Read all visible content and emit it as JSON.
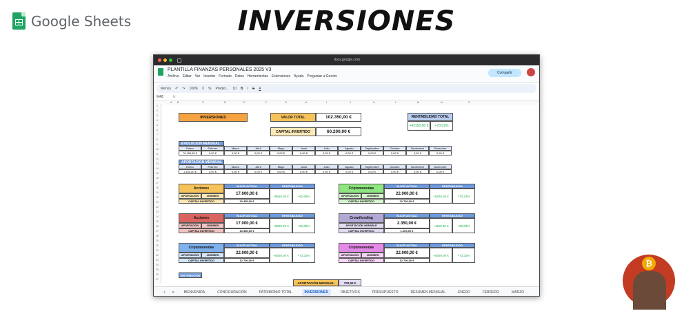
{
  "header": {
    "logo_text": "Google Sheets",
    "title": "INVERSIONES"
  },
  "browser": {
    "url": "docs.google.com"
  },
  "doc": {
    "title": "PLANTILLA FINANZAS PERSONALES 2025 V3",
    "menus": [
      "Archivo",
      "Editar",
      "Ver",
      "Insertar",
      "Formato",
      "Datos",
      "Herramientas",
      "Extensiones",
      "Ayuda",
      "Preguntar a Gemini"
    ],
    "share_label": "Compartir"
  },
  "toolbar": {
    "menus": "Menús",
    "zoom": "100%",
    "font": "Predet...",
    "font_size": "10"
  },
  "formula": {
    "cell_ref": "M48",
    "fx": "fx"
  },
  "columns": [
    "A",
    "B",
    "C",
    "D",
    "E",
    "F",
    "G",
    "H",
    "I",
    "J",
    "K",
    "L",
    "M",
    "N",
    "O"
  ],
  "summary": {
    "inversiones": "INVERSIONES",
    "valor_total_label": "VALOR TOTAL",
    "valor_total": "102.350,00 €",
    "capital_label": "CAPITAL INVERTIDO",
    "capital": "60.200,00 €",
    "rent_label": "RENTABILIDAD TOTAL",
    "rent_eur": "+42150,00 €",
    "rent_pct": "+70,02%"
  },
  "evolucion": {
    "label": "EVOLUCIÓN MENSUAL",
    "months": [
      "Enero",
      "Febrero",
      "Marzo",
      "Abril",
      "Mayo",
      "Junio",
      "Julio",
      "Agosto",
      "Septiembre",
      "Octubre",
      "Noviembre",
      "Diciembre"
    ],
    "values": [
      "76.163,89 €",
      "0,00 €",
      "0,00 €",
      "0,00 €",
      "0,00 €",
      "0,00 €",
      "0,00 €",
      "0,00 €",
      "0,00 €",
      "0,00 €",
      "0,00 €",
      "0,00 €"
    ]
  },
  "aportacion_mensual": {
    "label": "APORTACIÓN MENSUAL",
    "values": [
      "1.400,00 €",
      "0,00 €",
      "0,00 €",
      "0,00 €",
      "0,00 €",
      "0,00 €",
      "0,00 €",
      "0,00 €",
      "0,00 €",
      "0,00 €",
      "0,00 €",
      "0,00 €"
    ]
  },
  "blocks": [
    {
      "name": "Acciones",
      "color": "#f6c25a",
      "light": "#fde8b6",
      "ap_label": "APORTACIÓN",
      "ap_val": "400€/MES",
      "cap_label": "CAPITAL INVERTIDO",
      "va_label": "VALOR ACTUAL",
      "va": "17.000,00 €",
      "cap": "10.450,00 €",
      "rent_label": "RENTABILIDAD",
      "r1": "+6550,00 €",
      "r2": "+62,68%"
    },
    {
      "name": "Criptomonedas",
      "color": "#8ee680",
      "light": "#d6f6cf",
      "ap_label": "APORTACIÓN",
      "ap_val": "200€/MES",
      "cap_label": "CAPITAL INVERTIDO",
      "va_label": "VALOR ACTUAL",
      "va": "22.000,00 €",
      "cap": "12.700,00 €",
      "rent_label": "RENTABILIDAD",
      "r1": "+9300,00 €",
      "r2": "+73,23%"
    },
    {
      "name": "Acciones",
      "color": "#d9635f",
      "light": "#f2c4c2",
      "ap_label": "APORTACIÓN",
      "ap_val": "200€/MES",
      "cap_label": "CAPITAL INVERTIDO",
      "va_label": "VALOR ACTUAL",
      "va": "17.000,00 €",
      "cap": "10.450,00 €",
      "rent_label": "RENTABILIDAD",
      "r1": "+6550,00 €",
      "r2": "+62,68%"
    },
    {
      "name": "Crowdfunding",
      "color": "#b3a7d6",
      "light": "#e3ddf3",
      "ap_label": "APORTACIÓN VARIABLE",
      "ap_val": "",
      "cap_label": "CAPITAL INVERTIDO",
      "va_label": "VALOR ACTUAL",
      "va": "2.350,00 €",
      "cap": "1.200,00 €",
      "rent_label": "RENTABILIDAD",
      "r1": "+1150,00 €",
      "r2": "+95,83%"
    },
    {
      "name": "Criptomonedas",
      "color": "#7fb2ec",
      "light": "#d3e5f9",
      "ap_label": "APORTACIÓN",
      "ap_val": "400€/MES",
      "cap_label": "CAPITAL INVERTIDO",
      "va_label": "VALOR ACTUAL",
      "va": "22.000,00 €",
      "cap": "12.700,00 €",
      "rent_label": "RENTABILIDAD",
      "r1": "+9300,00 €",
      "r2": "+73,23%"
    },
    {
      "name": "Criptomonedas",
      "color": "#e58ae8",
      "light": "#f6d4f7",
      "ap_label": "APORTACIÓN",
      "ap_val": "200€/MES",
      "cap_label": "CAPITAL INVERTIDO",
      "va_label": "VALOR ACTUAL",
      "va": "22.000,00 €",
      "cap": "12.700,00 €",
      "rent_label": "RENTABILIDAD",
      "r1": "+9300,00 €",
      "r2": "+73,23%"
    }
  ],
  "distribucion": "DISTRIBUCIÓN",
  "aportacion_total": {
    "label": "APORTACIÓN MENSUAL",
    "value": "700,00 €"
  },
  "tabs": [
    "BIENVENIDA",
    "CONFIGURACIÓN",
    "PATRIMONIO TOTAL",
    "INVERSIONES",
    "OBJETIVOS",
    "PRESUPUESTO",
    "RESUMEN MENSUAL",
    "ENERO",
    "FEBRERO",
    "MARZO"
  ],
  "active_tab": "INVERSIONES",
  "avatar": {
    "coin": "₿"
  }
}
